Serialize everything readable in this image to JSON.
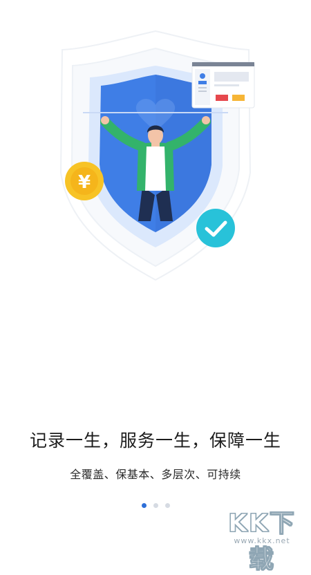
{
  "onboarding": {
    "headline": "记录一生，服务一生，保障一生",
    "subline": "全覆盖、保基本、多层次、可持续",
    "page_indicator": {
      "count": 3,
      "active_index": 0
    }
  },
  "illustration": {
    "coin_symbol": "¥",
    "colors": {
      "shield_blue": "#3f7ee6",
      "shield_light": "#cfe0fb",
      "person_jacket": "#33b36b",
      "coin_gold": "#f7c326",
      "check_teal": "#28c2d9"
    }
  },
  "watermark": {
    "logo_text": "KK下载",
    "url_text": "www.kkx.net"
  }
}
